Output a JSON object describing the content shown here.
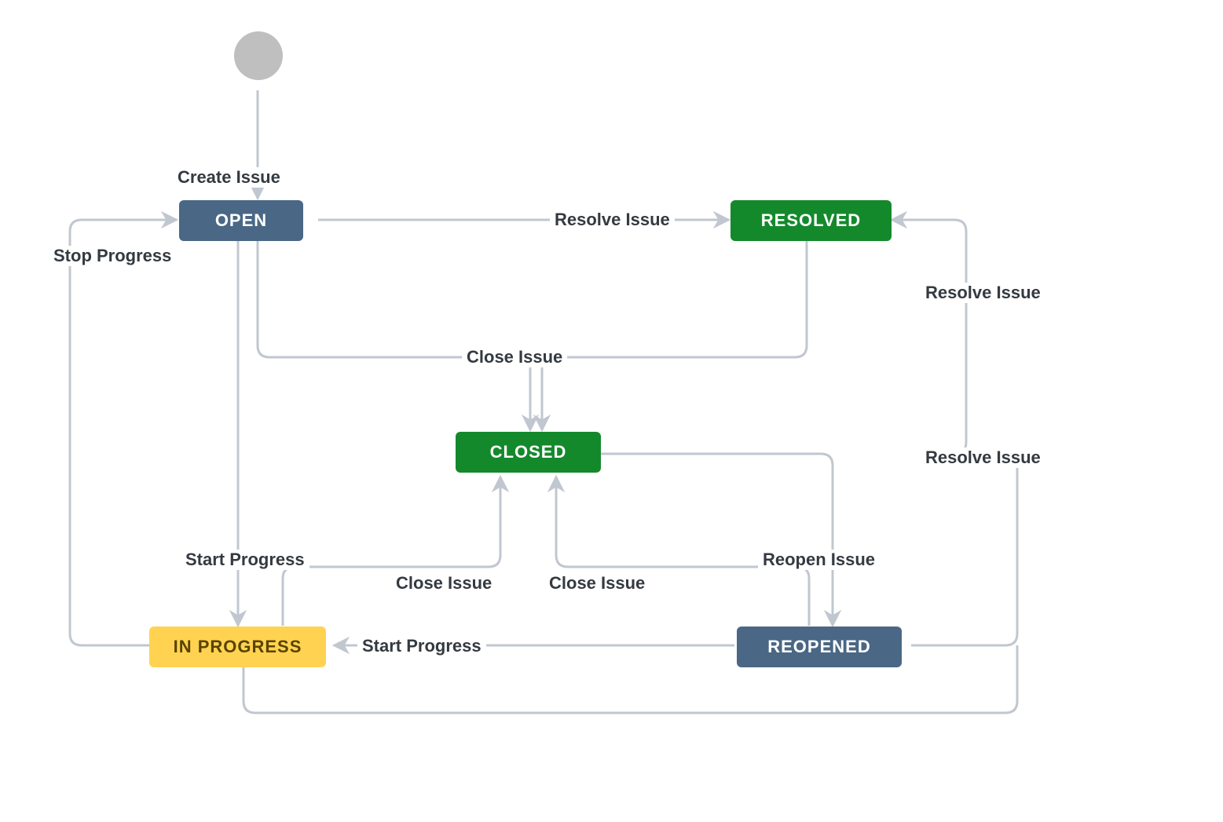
{
  "workflow": {
    "nodes": {
      "open": {
        "label": "OPEN"
      },
      "resolved": {
        "label": "RESOLVED"
      },
      "closed": {
        "label": "CLOSED"
      },
      "in_progress": {
        "label": "IN PROGRESS"
      },
      "reopened": {
        "label": "REOPENED"
      }
    },
    "edges": {
      "create_issue": "Create Issue",
      "resolve_issue_from_open": "Resolve Issue",
      "close_issue_top": "Close Issue",
      "stop_progress": "Stop Progress",
      "start_progress_left": "Start Progress",
      "start_progress_bottom": "Start Progress",
      "close_issue_left": "Close Issue",
      "close_issue_right": "Close Issue",
      "reopen_issue": "Reopen Issue",
      "resolve_issue_upper_right": "Resolve Issue",
      "resolve_issue_lower_right": "Resolve Issue"
    },
    "colors": {
      "blue": "#4a6785",
      "green": "#14892c",
      "yellow": "#ffd351",
      "start": "#bfbfbf",
      "arrow": "#c1c7d0",
      "text": "#343a40"
    }
  }
}
